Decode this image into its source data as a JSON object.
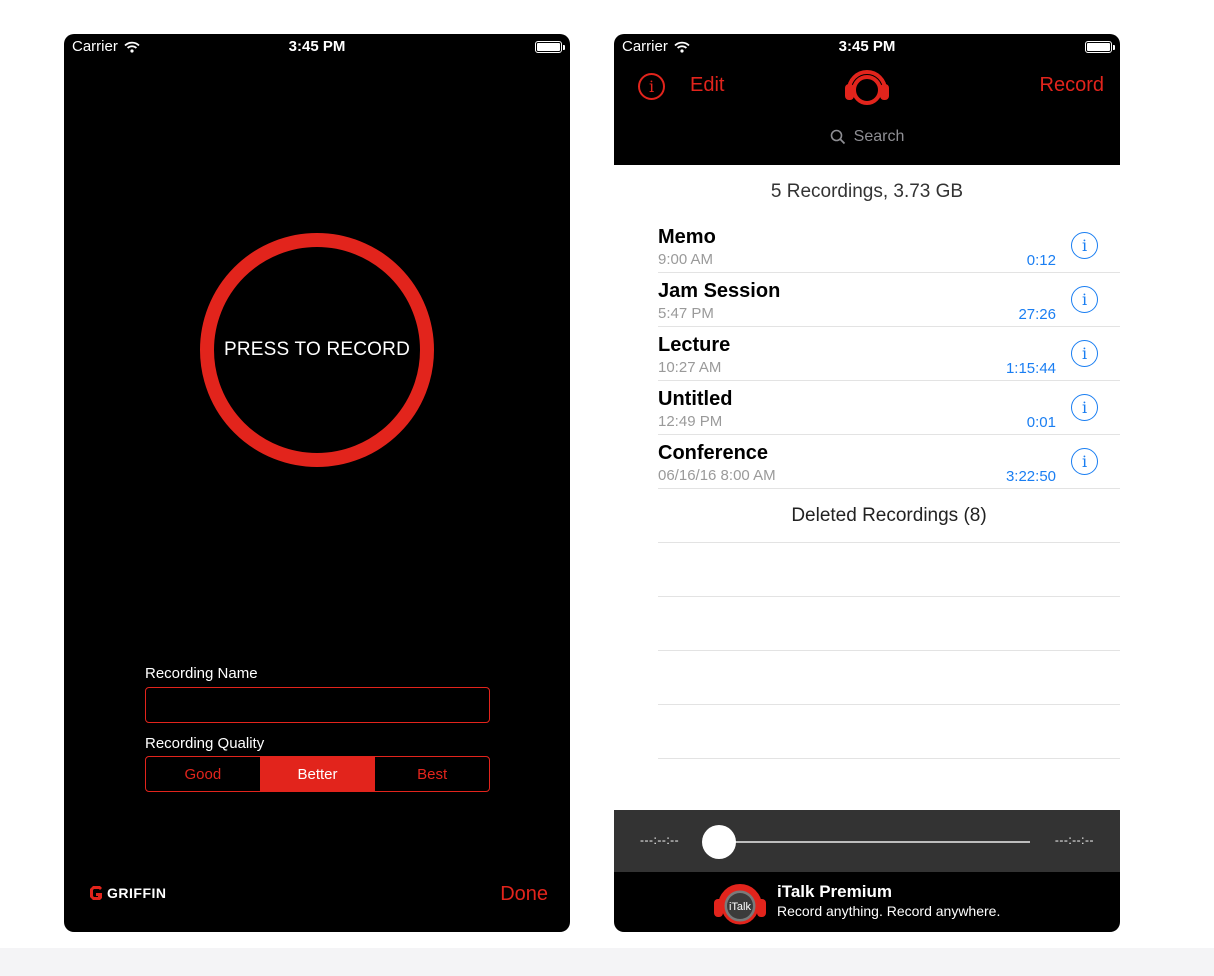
{
  "status_bar": {
    "carrier": "Carrier",
    "time": "3:45 PM"
  },
  "left_screen": {
    "record_button_label": "PRESS TO RECORD",
    "recording_name_label": "Recording Name",
    "recording_name_value": "",
    "recording_quality_label": "Recording Quality",
    "quality_options": [
      "Good",
      "Better",
      "Best"
    ],
    "selected_quality": "Better",
    "brand": "GRIFFIN",
    "done_label": "Done"
  },
  "right_screen": {
    "edit_label": "Edit",
    "record_label": "Record",
    "search_placeholder": "Search",
    "summary": "5 Recordings, 3.73 GB",
    "recordings": [
      {
        "title": "Memo",
        "time": "9:00 AM",
        "duration": "0:12"
      },
      {
        "title": "Jam Session",
        "time": "5:47 PM",
        "duration": "27:26"
      },
      {
        "title": "Lecture",
        "time": "10:27 AM",
        "duration": "1:15:44"
      },
      {
        "title": "Untitled",
        "time": "12:49 PM",
        "duration": "0:01"
      },
      {
        "title": "Conference",
        "time": "06/16/16 8:00 AM",
        "duration": "3:22:50"
      }
    ],
    "deleted_label": "Deleted Recordings (8)",
    "player": {
      "elapsed": "---:--:--",
      "remaining": "---:--:--",
      "progress": 0
    },
    "promo": {
      "icon_text": "iTalk",
      "title": "iTalk Premium",
      "subtitle": "Record anything. Record anywhere."
    }
  },
  "colors": {
    "accent_red": "#e2241c",
    "link_blue": "#1a7ef2"
  }
}
